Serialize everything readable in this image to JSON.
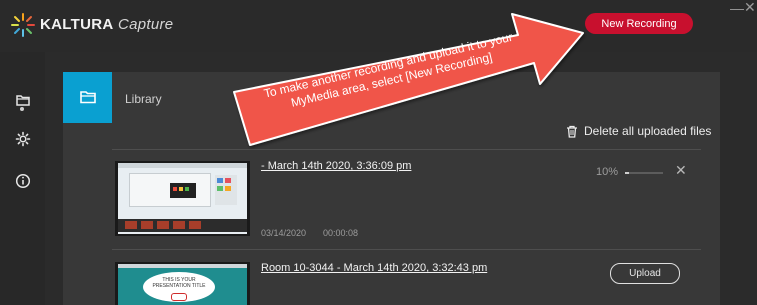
{
  "app": {
    "brand_bold": "KALTURA",
    "brand_light": "Capture"
  },
  "header": {
    "new_recording_label": "New Recording",
    "minimize_glyph": "—",
    "close_glyph": "✕"
  },
  "sidebar": {
    "items": [
      {
        "icon": "folder-icon",
        "active": true
      },
      {
        "icon": "gear-icon",
        "active": false
      },
      {
        "icon": "info-icon",
        "active": false
      }
    ]
  },
  "library": {
    "tab_label": "Library",
    "delete_all_label": "Delete all uploaded files"
  },
  "recordings": [
    {
      "title": "- March 14th 2020, 3:36:09 pm",
      "date": "03/14/2020",
      "duration": "00:00:08",
      "progress_label": "10%",
      "progress": 0.1
    },
    {
      "title": "Room 10-3044 - March 14th 2020, 3:32:43 pm",
      "upload_label": "Upload",
      "thumb_text_1": "THIS IS YOUR",
      "thumb_text_2": "PRESENTATION TITLE"
    }
  ],
  "annotation": {
    "text": "To make another recording and upload it to your MyMedia area, select [New Recording]",
    "color": "#f0544a"
  },
  "colors": {
    "accent_blue": "#0aa0d1",
    "record_red": "#c8102e"
  }
}
